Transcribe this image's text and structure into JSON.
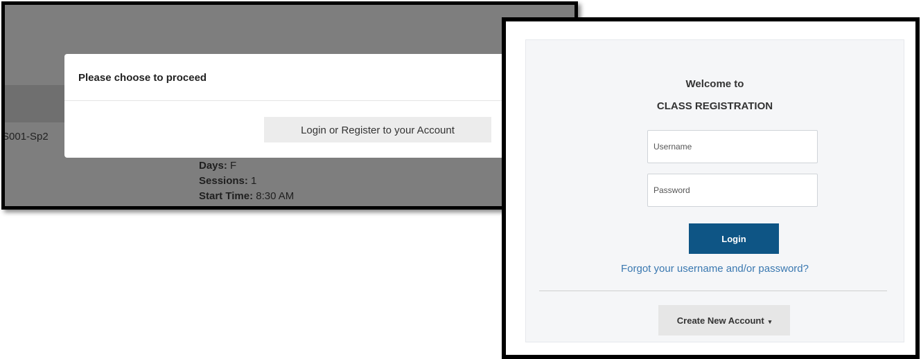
{
  "left": {
    "course_code": "S001-Sp2",
    "modal": {
      "title": "Please choose to proceed",
      "button_label": "Login or Register to your Account"
    },
    "details": [
      {
        "label": "Days:",
        "value": "F"
      },
      {
        "label": "Sessions:",
        "value": "1"
      },
      {
        "label": "Start Time:",
        "value": "8:30 AM"
      }
    ]
  },
  "right": {
    "welcome_line1": "Welcome to",
    "welcome_line2": "CLASS REGISTRATION",
    "username_placeholder": "Username",
    "password_placeholder": "Password",
    "login_label": "Login",
    "forgot_link": "Forgot your username and/or password?",
    "create_account_label": "Create New Account",
    "create_account_caret": "▾"
  },
  "colors": {
    "login_button": "#0e5585",
    "link": "#3a78b0",
    "overlay": "#7e7e7e"
  }
}
